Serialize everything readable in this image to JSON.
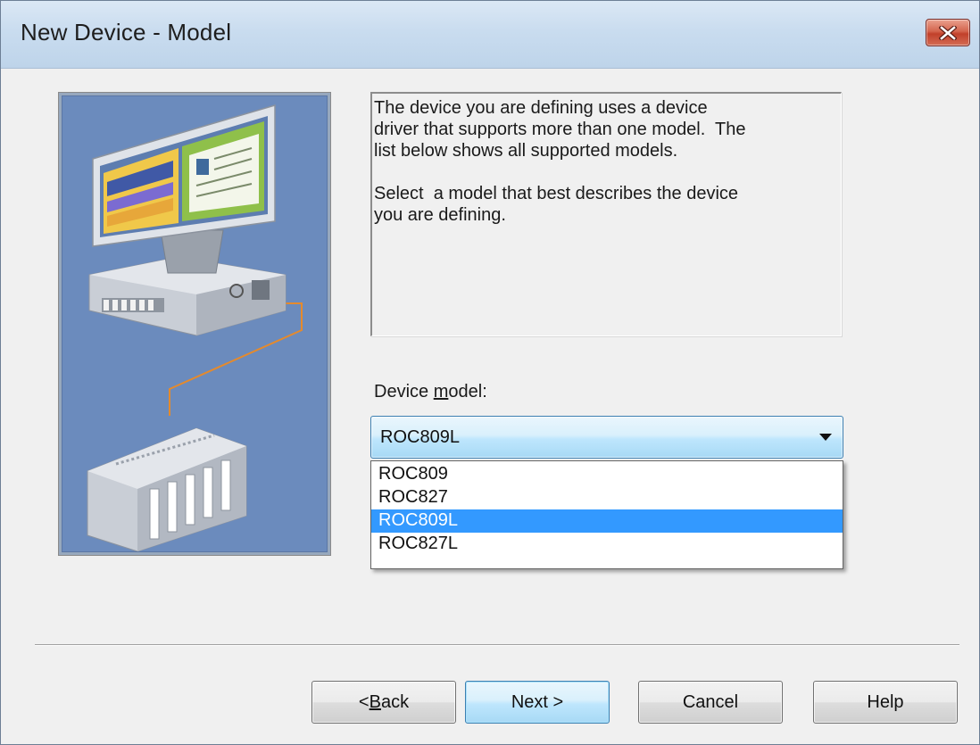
{
  "window": {
    "title": "New Device - Model",
    "close_icon": "close-icon"
  },
  "illustration": {
    "icon": "computer-network-illustration"
  },
  "info": {
    "text": "The device you are defining uses a device\ndriver that supports more than one model.  The\nlist below shows all supported models.\n\nSelect  a model that best describes the device\nyou are defining."
  },
  "model": {
    "label_pre": "Device ",
    "label_accel": "m",
    "label_post": "odel:",
    "selected": "ROC809L",
    "options": [
      "ROC809",
      "ROC827",
      "ROC809L",
      "ROC827L"
    ],
    "highlighted_index": 2
  },
  "buttons": {
    "back_pre": "< ",
    "back_accel": "B",
    "back_post": "ack",
    "next": "Next >",
    "cancel": "Cancel",
    "help": "Help"
  },
  "colors": {
    "selection": "#3399ff",
    "illustration_bg": "#6b8bbd",
    "close_button": "#c1402a"
  }
}
